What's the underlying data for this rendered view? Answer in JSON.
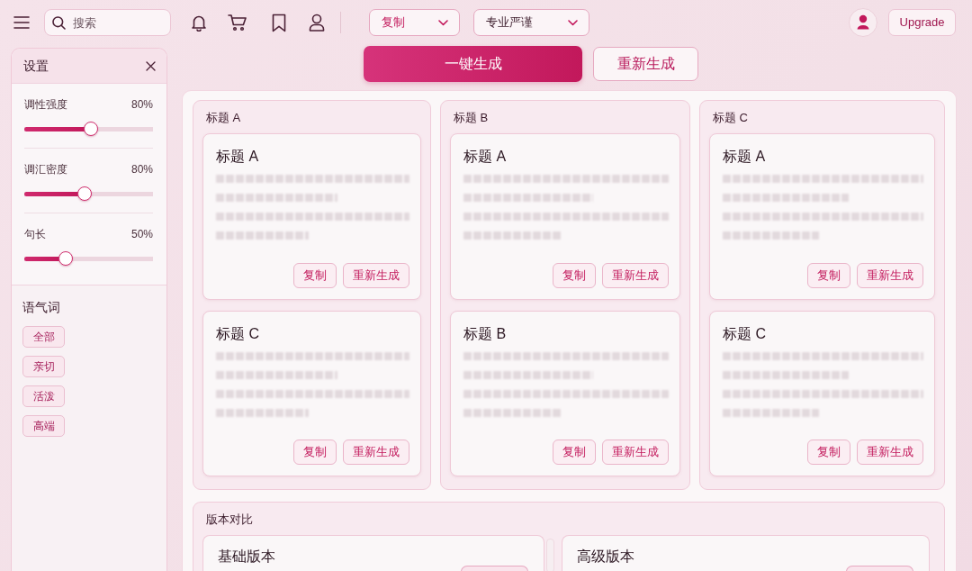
{
  "topbar": {
    "search": {
      "placeholder": "搜索"
    },
    "dropdowns": [
      {
        "value": "复制",
        "kind": "accent"
      },
      {
        "value": "专业严谨",
        "kind": "plain"
      }
    ],
    "upgrade": "Upgrade"
  },
  "settings": {
    "title": "设置",
    "sliders": [
      {
        "label": "调性强度",
        "reading": "80%",
        "level": 0.52
      },
      {
        "label": "调汇密度",
        "reading": "80%",
        "level": 0.47
      },
      {
        "label": "句长",
        "reading": "50%",
        "level": 0.32
      }
    ],
    "tone_words": {
      "title": "语气词",
      "tags": [
        "全部",
        "亲切",
        "活泼",
        "高端"
      ]
    }
  },
  "actions": [
    {
      "label": "一键生成",
      "kind": "primary"
    },
    {
      "label": "重新生成",
      "kind": "outline"
    }
  ],
  "columns": [
    {
      "title": "标题 A",
      "cards": [
        {
          "title": "标题 A",
          "buttons": [
            "复制",
            "重新生成"
          ]
        },
        {
          "title": "标题 C",
          "buttons": [
            "复制",
            "重新生成"
          ]
        }
      ]
    },
    {
      "title": "标题 B",
      "cards": [
        {
          "title": "标题 A",
          "buttons": [
            "复制",
            "重新生成"
          ]
        },
        {
          "title": "标题 B",
          "buttons": [
            "复制",
            "重新生成"
          ]
        }
      ]
    },
    {
      "title": "标题 C",
      "cards": [
        {
          "title": "标题 A",
          "buttons": [
            "复制",
            "重新生成"
          ]
        },
        {
          "title": "标题 C",
          "buttons": [
            "复制",
            "重新生成"
          ]
        }
      ]
    }
  ],
  "comparison": {
    "title": "版本对比",
    "cards": [
      {
        "title": "基础版本"
      },
      {
        "title": "高级版本"
      }
    ]
  }
}
